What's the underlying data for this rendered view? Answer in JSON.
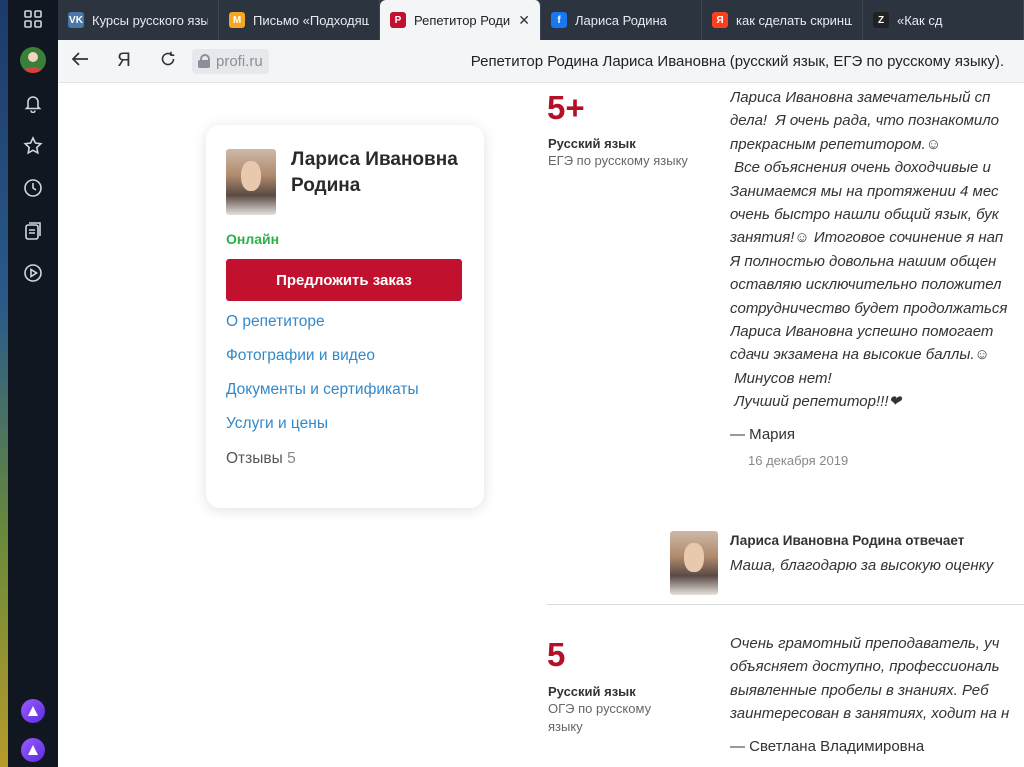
{
  "browser": {
    "tabs": [
      {
        "label": "Курсы русского язык",
        "icon": "vk-icon",
        "color": "#4a76a8",
        "glyph": "VK"
      },
      {
        "label": "Письмо «Подходящ",
        "icon": "mail-icon",
        "color": "#f5a623",
        "glyph": "M"
      },
      {
        "label": "Репетитор Родин",
        "icon": "profi-icon",
        "color": "#c2112e",
        "glyph": "P",
        "active": true
      },
      {
        "label": "Лариса Родина",
        "icon": "facebook-icon",
        "color": "#1877f2",
        "glyph": "f"
      },
      {
        "label": "как сделать скринш",
        "icon": "yandex-icon",
        "color": "#fc3f1d",
        "glyph": "Я"
      },
      {
        "label": "«Как сд",
        "icon": "zen-icon",
        "color": "#222222",
        "glyph": "Z"
      }
    ],
    "close_glyph": "✕",
    "url_host": "profi.ru",
    "yandex_glyph": "Я",
    "page_title": "Репетитор Родина Лариса Ивановна (русский язык, ЕГЭ по русскому языку)."
  },
  "profile": {
    "name": "Лариса Ивановна Родина",
    "status": "Онлайн",
    "order_button": "Предложить заказ",
    "links": {
      "about": "О репетиторе",
      "media": "Фотографии и видео",
      "documents": "Документы и сертификаты",
      "services": "Услуги и цены",
      "reviews": "Отзывы",
      "reviews_count": "5"
    }
  },
  "reviews": [
    {
      "rating": "5+",
      "subject": "Русский язык",
      "exam": "ЕГЭ по русскому языку",
      "text": "Лариса Ивановна замечательный сп\nдела!  Я очень рада, что познакомило\nпрекрасным репетитором.☺\n Все объяснения очень доходчивые и\nЗанимаемся мы на протяжении 4 мес\nочень быстро нашли общий язык, бук\nзанятия!☺ Итоговое сочинение я нап\nЯ полностью довольна нашим общен\nоставляю исключительно положител\nсотрудничество будет продолжаться\nЛариса Ивановна успешно помогает\nсдачи экзамена на высокие баллы.☺\n Минусов нет!\n Лучший репетитор!!!❤",
      "author": "— Мария",
      "date": "16 декабря 2019"
    },
    {
      "rating": "5",
      "subject": "Русский язык",
      "exam": "ОГЭ по русскому языку",
      "text": "Очень грамотный преподаватель, уч\nобъясняет доступно, профессиональ\nвыявленные пробелы в знаниях. Реб\nзаинтересован в занятиях, ходит на н",
      "author": "— Светлана Владимировна"
    }
  ],
  "reply": {
    "heading": "Лариса Ивановна Родина отвечает",
    "text": "Маша, благодарю за высокую оценку"
  }
}
